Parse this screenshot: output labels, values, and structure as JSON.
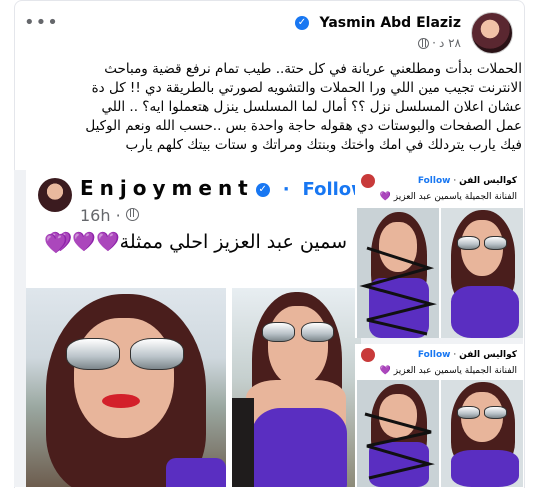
{
  "post": {
    "author": "Yasmin Abd Elaziz",
    "time": "٢٨ د",
    "separator": "·",
    "more_label": "•••",
    "text_lines": [
      "الحملات بدأت  ومطلعني عريانة في كل حتة.. طيب تمام نرفع قضية ومباحث",
      "الانترنت تجيب مين اللي ورا الحملات والتشويه لصورتي بالطريقة دي !! كل دة",
      "عشان اعلان المسلسل نزل ؟؟ أمال لما  المسلسل  ينزل هتعملوا ايه؟ .. اللي",
      "عمل الصفحات والبوستات دي هقوله حاجة واحدة بس ..حسب الله ونعم الوكيل",
      "فيك يارب يتردلك في امك واختك وبنتك ومراتك و ستات بيتك كلهم يارب"
    ]
  },
  "shared_post": {
    "page_name": "Enjoyment",
    "follow_label": "Follow",
    "time": "16h",
    "separator": "·",
    "caption": "سمين عبد العزيز احلي ممثلة",
    "hearts": "💜💜💜",
    "hearts_after": "💜"
  },
  "side_posts": [
    {
      "page_name": "كواليس الفن",
      "follow_label": "Follow",
      "separator": "·",
      "caption": "الفنانة الجميلة ياسمين عبد العزيز",
      "heart": "💜"
    },
    {
      "page_name": "كواليس الفن",
      "follow_label": "Follow",
      "separator": "·",
      "caption": "الفنانة الجميلة ياسمين عبد العزيز",
      "heart": "💜"
    }
  ],
  "icons": {
    "verified": "verified-badge-icon",
    "globe": "globe-icon",
    "more": "more-options-icon"
  },
  "colors": {
    "link_blue": "#1877f2",
    "meta_gray": "#65676b",
    "swimsuit_purple": "#5a2ec1",
    "heart_purple": "#8a3ddb"
  }
}
